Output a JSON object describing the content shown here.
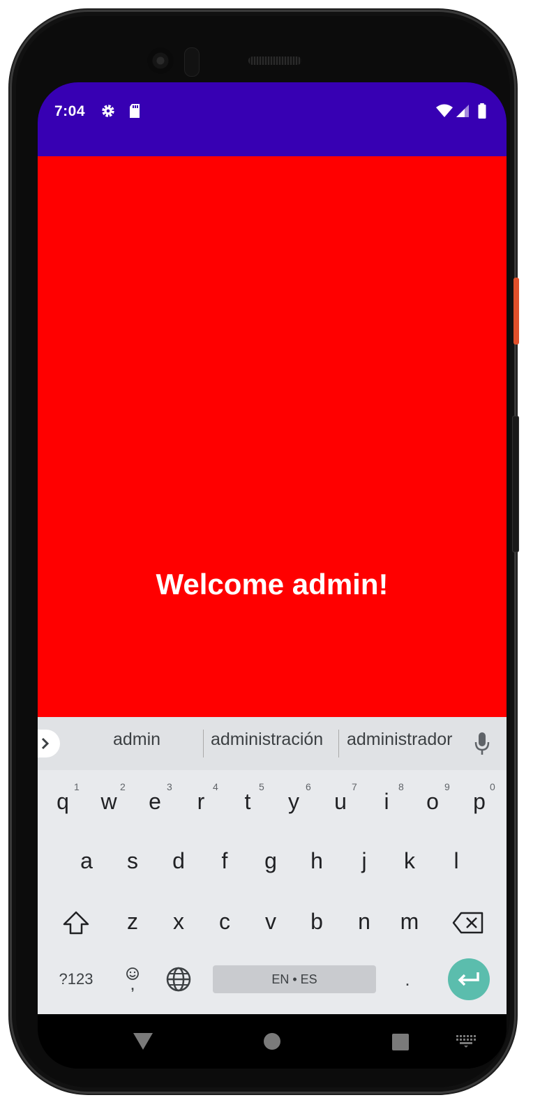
{
  "status_bar": {
    "time": "7:04",
    "left_icons": [
      "gear-icon",
      "sd-card-icon"
    ],
    "right_icons": [
      "wifi-icon",
      "signal-icon",
      "battery-icon"
    ],
    "color": "#3700b3"
  },
  "screen": {
    "background": "#ff0000",
    "welcome_text": "Welcome admin!"
  },
  "keyboard": {
    "suggestions": [
      "admin",
      "administración",
      "administrador"
    ],
    "row1": [
      {
        "key": "q",
        "hint": "1"
      },
      {
        "key": "w",
        "hint": "2"
      },
      {
        "key": "e",
        "hint": "3"
      },
      {
        "key": "r",
        "hint": "4"
      },
      {
        "key": "t",
        "hint": "5"
      },
      {
        "key": "y",
        "hint": "6"
      },
      {
        "key": "u",
        "hint": "7"
      },
      {
        "key": "i",
        "hint": "8"
      },
      {
        "key": "o",
        "hint": "9"
      },
      {
        "key": "p",
        "hint": "0"
      }
    ],
    "row2": [
      "a",
      "s",
      "d",
      "f",
      "g",
      "h",
      "j",
      "k",
      "l"
    ],
    "row3": [
      "z",
      "x",
      "c",
      "v",
      "b",
      "n",
      "m"
    ],
    "symbols_label": "?123",
    "emoji_key_secondary": ",",
    "space_label": "EN • ES",
    "period_label": ".",
    "enter_color": "#5bbdad"
  },
  "nav_bar": {
    "buttons": [
      "back-icon",
      "home-icon",
      "recents-icon",
      "keyboard-switch-icon"
    ]
  }
}
